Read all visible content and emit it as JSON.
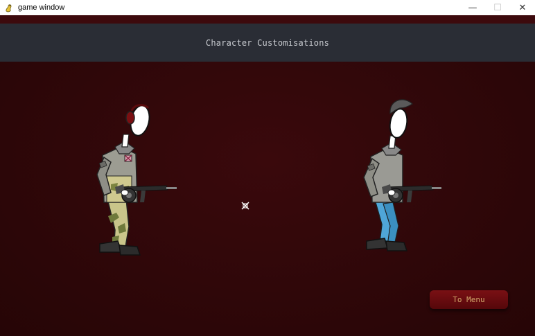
{
  "window": {
    "title": "game window",
    "icon": "pygame-snake-icon",
    "controls": [
      {
        "name": "minimize",
        "glyph": "—"
      },
      {
        "name": "maximize",
        "glyph": "☐",
        "disabled": true
      },
      {
        "name": "close",
        "glyph": "✕"
      }
    ]
  },
  "screen": {
    "title": "Character Customisations",
    "menu_button_label": "To Menu"
  },
  "characters": [
    {
      "slot": "left",
      "headgear": "red headphones",
      "outfit": "camouflage"
    },
    {
      "slot": "right",
      "headgear": "grey hair",
      "outfit": "blue jeans"
    }
  ],
  "colors": {
    "background": "#2f0709",
    "header_bar": "#2a2d35",
    "header_text": "#c9ccd1",
    "button": "#6a0c10",
    "button_text": "#d1a66a"
  }
}
